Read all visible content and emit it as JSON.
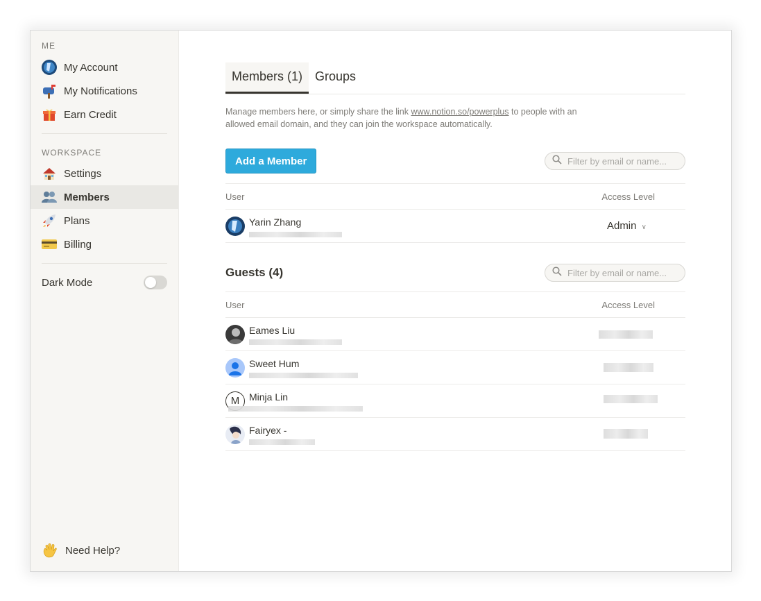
{
  "sidebar": {
    "me_label": "ME",
    "me_items": [
      {
        "label": "My Account",
        "icon": "user-avatar-icon"
      },
      {
        "label": "My Notifications",
        "icon": "mailbox-icon"
      },
      {
        "label": "Earn Credit",
        "icon": "gift-icon"
      }
    ],
    "workspace_label": "WORKSPACE",
    "workspace_items": [
      {
        "label": "Settings",
        "icon": "house-icon"
      },
      {
        "label": "Members",
        "icon": "people-icon",
        "active": true
      },
      {
        "label": "Plans",
        "icon": "rocket-icon"
      },
      {
        "label": "Billing",
        "icon": "credit-card-icon"
      }
    ],
    "dark_mode_label": "Dark Mode",
    "dark_mode_on": false,
    "help_label": "Need Help?"
  },
  "tabs": [
    {
      "label": "Members (1)",
      "active": true
    },
    {
      "label": "Groups",
      "active": false
    }
  ],
  "description": {
    "before": "Manage members here, or simply share the link ",
    "link": "www.notion.so/powerplus",
    "after": " to people with an allowed email domain, and they can join the workspace automatically."
  },
  "members": {
    "add_button": "Add a Member",
    "filter_placeholder": "Filter by email or name...",
    "col_user": "User",
    "col_access": "Access Level",
    "rows": [
      {
        "name": "Yarin Zhang",
        "access": "Admin"
      }
    ]
  },
  "guests": {
    "title": "Guests (4)",
    "filter_placeholder": "Filter by email or name...",
    "col_user": "User",
    "col_access": "Access Level",
    "rows": [
      {
        "name": "Eames Liu"
      },
      {
        "name": "Sweet Hum"
      },
      {
        "name": "Minja Lin",
        "initial": "M"
      },
      {
        "name": "Fairyex -"
      }
    ]
  },
  "colors": {
    "accent": "#2eaadc",
    "sidebar_bg": "#f7f6f3",
    "text": "#37352f"
  }
}
